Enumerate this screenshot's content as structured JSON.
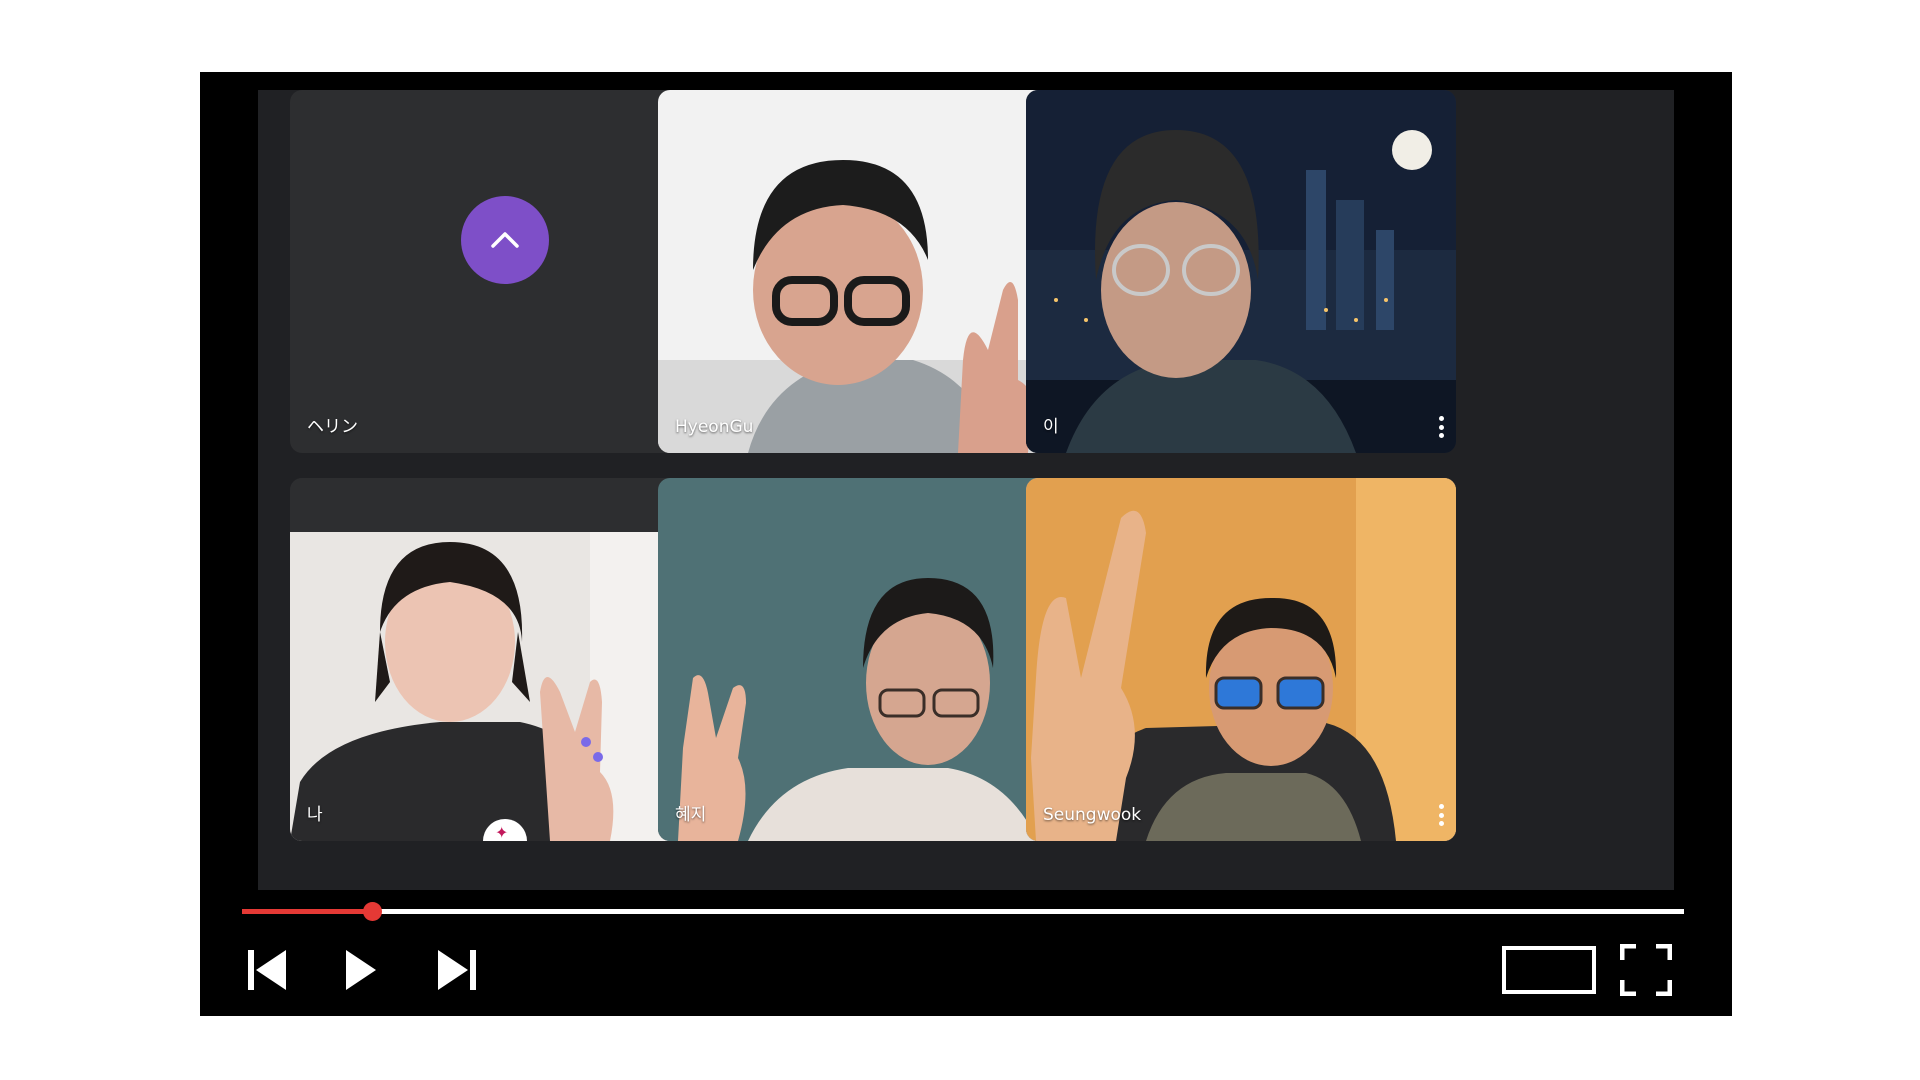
{
  "participants": [
    {
      "name": "ヘリン",
      "video": false,
      "avatar_color": "#7e4fc8",
      "avatar_icon": "chevron-up-icon"
    },
    {
      "name": "HyeonGu",
      "video": true
    },
    {
      "name": "이",
      "video": true
    },
    {
      "name": "나",
      "video": true,
      "top_badge": "more-options-icon",
      "bottom_badge": "sparkle-icon"
    },
    {
      "name": "혜지",
      "video": true
    },
    {
      "name": "Seungwook",
      "video": true,
      "active_speaker": true
    }
  ],
  "player": {
    "progress_fraction": 0.09,
    "progress_color": "#e53935",
    "controls": [
      "previous-icon",
      "play-icon",
      "next-icon",
      "theater-mode-icon",
      "fullscreen-icon"
    ]
  }
}
